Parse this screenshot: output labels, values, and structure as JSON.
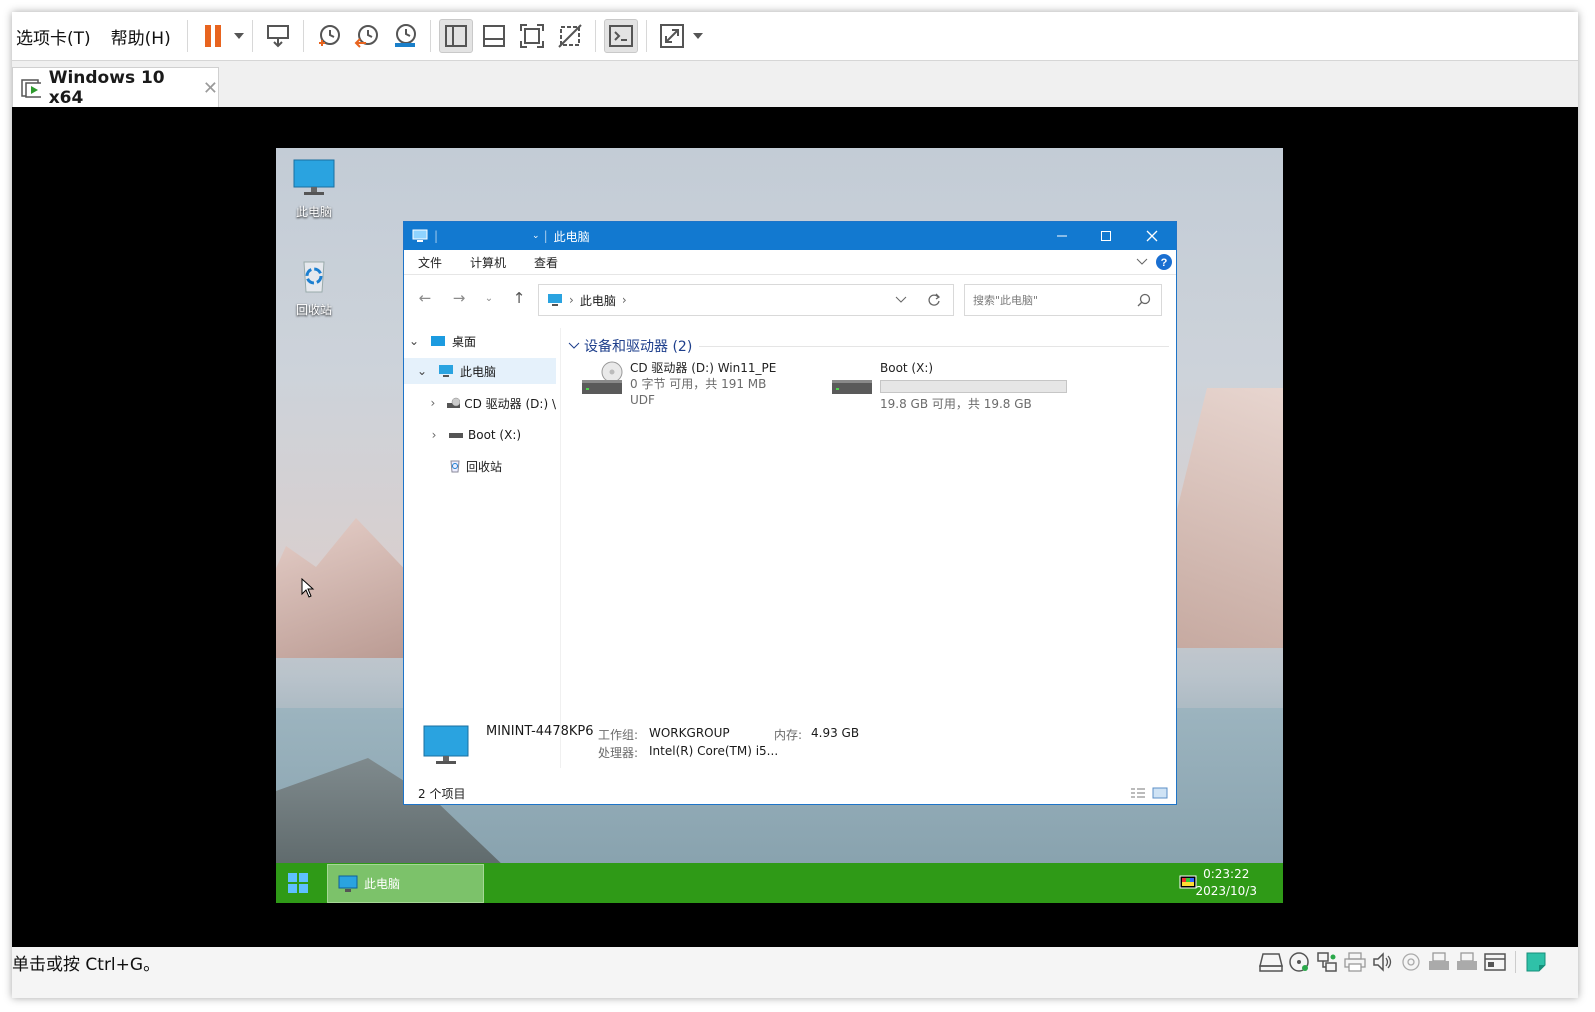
{
  "menu": {
    "tabs_label": "选项卡(T)",
    "help_label": "帮助(H)"
  },
  "tab": {
    "title": "Windows 10 x64",
    "close": "✕"
  },
  "desktop": {
    "icons": [
      {
        "label": "此电脑"
      },
      {
        "label": "回收站"
      }
    ]
  },
  "explorer": {
    "title": "此电脑",
    "ribbon": [
      "文件",
      "计算机",
      "查看"
    ],
    "address": {
      "path": "此电脑",
      "sep1": "›",
      "sep2": "›"
    },
    "search_placeholder": "搜索\"此电脑\"",
    "nav_tree": [
      {
        "label": "桌面",
        "expander": "⌄"
      },
      {
        "label": "此电脑",
        "expander": "⌄"
      },
      {
        "label": "CD 驱动器 (D:) \\",
        "expander": "›"
      },
      {
        "label": "Boot (X:)",
        "expander": "›"
      },
      {
        "label": "回收站",
        "expander": ""
      }
    ],
    "section": {
      "title": "设备和驱动器 (2)"
    },
    "drives": [
      {
        "name": "CD 驱动器 (D:) Win11_PE",
        "line2": "0 字节 可用，共 191 MB",
        "line3": "UDF"
      },
      {
        "name": "Boot (X:)",
        "free_text": "19.8 GB 可用，共 19.8 GB",
        "used_fraction": 0.0
      }
    ],
    "details": {
      "computer_name": "MININT-4478KP6",
      "workgroup_label": "工作组:",
      "workgroup": "WORKGROUP",
      "memory_label": "内存:",
      "memory": "4.93 GB",
      "cpu_label": "处理器:",
      "cpu": "Intel(R) Core(TM) i5..."
    },
    "status": {
      "count": "2 个项目"
    }
  },
  "taskbar": {
    "task_label": "此电脑",
    "time": "0:23:22",
    "date": "2023/10/3"
  },
  "host_status": {
    "hint": "单击或按 Ctrl+G。"
  },
  "colors": {
    "accent": "#1279d0",
    "taskbar": "#2f9a17",
    "pause": "#e8641f"
  }
}
